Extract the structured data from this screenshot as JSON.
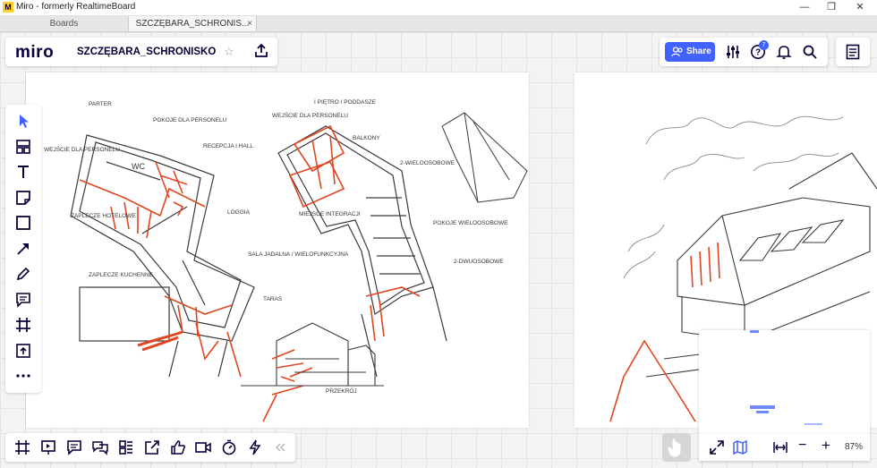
{
  "window": {
    "title": "Miro - formerly RealtimeBoard",
    "logo_letter": "M",
    "controls": {
      "minimize": "—",
      "restore": "❐",
      "close": "✕"
    }
  },
  "tabs": [
    {
      "label": "Boards"
    },
    {
      "label": "SZCZĘBARA_SCHRONIS...",
      "close": "×"
    }
  ],
  "header": {
    "logo": "miro",
    "board_name": "SZCZĘBARA_SCHRONISKO",
    "star_icon": "star-icon",
    "upload_icon": "upload-icon"
  },
  "toolbar_right": {
    "share_label": "Share",
    "help_badge": "7",
    "icons": [
      "users-icon",
      "settings-sliders-icon",
      "help-icon",
      "bell-icon",
      "search-icon",
      "notes-icon"
    ]
  },
  "left_toolbar": [
    "cursor-icon",
    "templates-icon",
    "text-icon",
    "sticky-note-icon",
    "shape-icon",
    "arrow-icon",
    "pen-icon",
    "comment-icon",
    "frame-icon",
    "upload-icon",
    "more-icon"
  ],
  "bottom_toolbar": [
    "frames-icon",
    "presentation-icon",
    "comments-icon",
    "chat-icon",
    "card-icon",
    "export-icon",
    "reaction-icon",
    "video-icon",
    "timer-icon",
    "activity-icon",
    "collapse-icon"
  ],
  "zoom": {
    "percent": "87%",
    "minus": "−",
    "plus": "+"
  },
  "sketch_labels": {
    "parter": "PARTER",
    "pietro": "I PIĘTRO / PODDASZE",
    "pokoje": "POKOJE DLA PERSONELU",
    "wc": "WC",
    "recepcja": "RECEPCJA I HALL",
    "loggia": "LOGGIA",
    "zaplecze_hotelowe": "ZAPLECZE HOTELOWE",
    "zaplecze_kuchenne": "ZAPLECZE KUCHENNE",
    "sala": "SALA JADALNA / WIELOFUNKCYJNA",
    "taras": "TARAS",
    "przekroj": "PRZEKRÓJ",
    "balkony": "BALKONY",
    "wieloosobowe": "2-WIELOOSOBOWE",
    "pokoje_wieloosobowe": "POKOJE WIELOOSOBOWE",
    "dwuosobowe": "2-DWUOSOBOWE",
    "miejsce": "MIEJSCE INTEGRACJI",
    "wejscie": "WEJŚCIE DLA PERSONELU",
    "wejscie2": "WEJŚCIE DLA PERSONELU"
  },
  "colors": {
    "accent": "#4262ff",
    "sketch_red": "#e0461f",
    "sketch_ink": "#3a3a3a"
  }
}
